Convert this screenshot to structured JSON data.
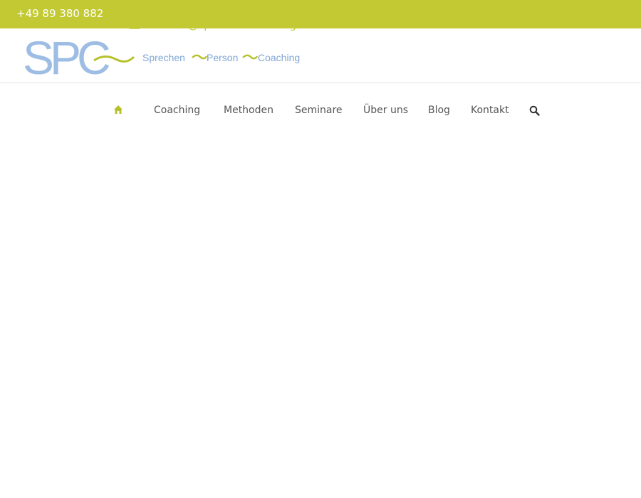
{
  "topbar": {
    "phone": "+49 89 380 882",
    "email": "kontakt@sprecher-coaching.de",
    "colors": {
      "bar": "#c2c932",
      "text": "#ffffff"
    }
  },
  "header": {
    "logo": {
      "initials": "SPC",
      "word1": "Sprechen",
      "word2": "Person",
      "word3": "Coaching",
      "colors": {
        "letters": "#9dbde4",
        "wave": "#b7c12c",
        "words": "#7fa6d6"
      }
    }
  },
  "nav": {
    "home_icon": "home-icon",
    "items": [
      {
        "label": "Coaching"
      },
      {
        "label": "Methoden"
      },
      {
        "label": "Seminare"
      },
      {
        "label": "Über uns"
      },
      {
        "label": "Blog"
      },
      {
        "label": "Kontakt"
      }
    ],
    "search_icon": "search-icon",
    "accent": "#b7c12c"
  }
}
